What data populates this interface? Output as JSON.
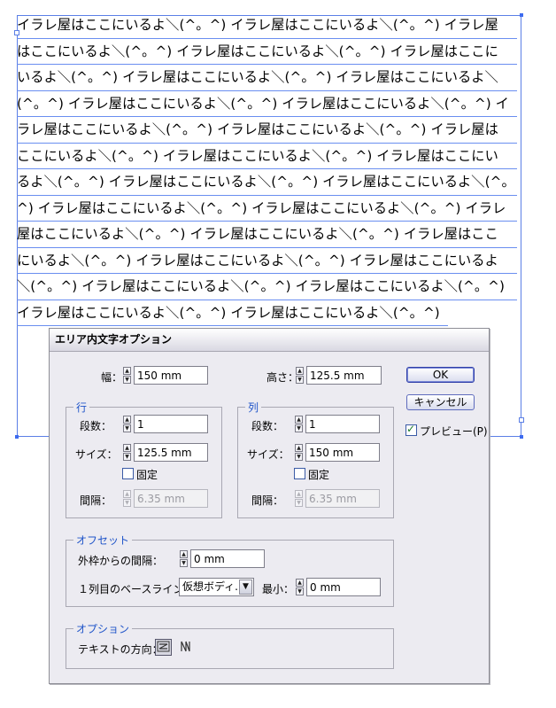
{
  "canvas": {
    "text_lines": [
      "イラレ屋はここにいるよ＼(^。^) イラレ屋はここにいるよ＼(^。^) イラレ屋",
      "はここにいるよ＼(^。^) イラレ屋はここにいるよ＼(^。^) イラレ屋はここに",
      "いるよ＼(^。^) イラレ屋はここにいるよ＼(^。^) イラレ屋はここにいるよ＼",
      "(^。^) イラレ屋はここにいるよ＼(^。^) イラレ屋はここにいるよ＼(^。^) イ",
      "ラレ屋はここにいるよ＼(^。^) イラレ屋はここにいるよ＼(^。^) イラレ屋は",
      "ここにいるよ＼(^。^) イラレ屋はここにいるよ＼(^。^) イラレ屋はここにい",
      "るよ＼(^。^) イラレ屋はここにいるよ＼(^。^) イラレ屋はここにいるよ＼(^。",
      "^) イラレ屋はここにいるよ＼(^。^) イラレ屋はここにいるよ＼(^。^) イラレ",
      "屋はここにいるよ＼(^。^) イラレ屋はここにいるよ＼(^。^) イラレ屋はここ",
      "にいるよ＼(^。^) イラレ屋はここにいるよ＼(^。^) イラレ屋はここにいるよ",
      "＼(^。^) イラレ屋はここにいるよ＼(^。^) イラレ屋はここにいるよ＼(^。^)",
      "イラレ屋はここにいるよ＼(^。^) イラレ屋はここにいるよ＼(^。^)"
    ]
  },
  "dialog": {
    "title": "エリア内文字オプション",
    "width_label": "幅：",
    "width_value": "150 mm",
    "height_label": "高さ：",
    "height_value": "125.5 mm",
    "rows": {
      "title": "行",
      "count_label": "段数：",
      "count_value": "1",
      "size_label": "サイズ：",
      "size_value": "125.5 mm",
      "fixed_label": "固定",
      "gutter_label": "間隔：",
      "gutter_value": "6.35 mm"
    },
    "columns": {
      "title": "列",
      "count_label": "段数：",
      "count_value": "1",
      "size_label": "サイズ：",
      "size_value": "150 mm",
      "fixed_label": "固定",
      "gutter_label": "間隔：",
      "gutter_value": "6.35 mm"
    },
    "offset": {
      "title": "オフセット",
      "inset_label": "外枠からの間隔：",
      "inset_value": "0 mm",
      "baseline_label": "１列目のベースライン：",
      "baseline_value": "仮想ボディ...",
      "min_label": "最小：",
      "min_value": "0 mm"
    },
    "options": {
      "title": "オプション",
      "direction_label": "テキストの方向："
    },
    "ok_label": "OK",
    "cancel_label": "キャンセル",
    "preview_label": "プレビュー(P)",
    "preview_checked": true
  }
}
